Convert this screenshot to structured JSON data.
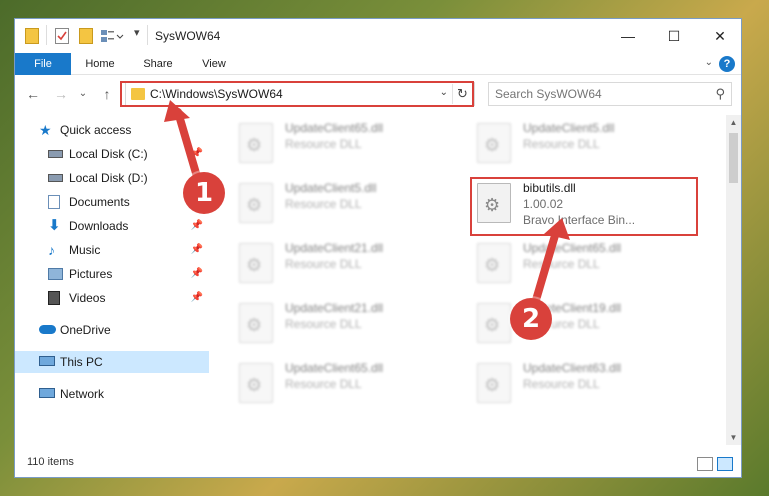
{
  "window": {
    "title": "SysWOW64",
    "controls": {
      "minimize": "—",
      "maximize": "☐",
      "close": "✕"
    }
  },
  "ribbon": {
    "tabs": [
      "File",
      "Home",
      "Share",
      "View"
    ],
    "help": "?"
  },
  "navigation": {
    "back": "←",
    "forward": "→",
    "recent": "⌄",
    "up": "↑",
    "address": "C:\\Windows\\SysWOW64",
    "search_placeholder": "Search SysWOW64"
  },
  "sidebar": {
    "items": [
      {
        "label": "Quick access",
        "icon": "star-icon",
        "pinned": false
      },
      {
        "label": "Local Disk (C:)",
        "icon": "drive-icon",
        "pinned": true
      },
      {
        "label": "Local Disk (D:)",
        "icon": "drive-icon",
        "pinned": false
      },
      {
        "label": "Documents",
        "icon": "documents-icon",
        "pinned": true
      },
      {
        "label": "Downloads",
        "icon": "download-icon",
        "pinned": true
      },
      {
        "label": "Music",
        "icon": "music-icon",
        "pinned": true
      },
      {
        "label": "Pictures",
        "icon": "pictures-icon",
        "pinned": true
      },
      {
        "label": "Videos",
        "icon": "videos-icon",
        "pinned": true
      },
      {
        "label": "OneDrive",
        "icon": "cloud-icon",
        "pinned": false
      },
      {
        "label": "This PC",
        "icon": "computer-icon",
        "pinned": false,
        "selected": true
      },
      {
        "label": "Network",
        "icon": "network-icon",
        "pinned": false
      }
    ],
    "pin_glyph": "📌"
  },
  "files": {
    "left_column": [
      {
        "name": "UpdateClient65.dll",
        "type": "Resource DLL"
      },
      {
        "name": "UpdateClient5.dll",
        "type": "Resource DLL"
      },
      {
        "name": "UpdateClient21.dll",
        "type": "Resource DLL"
      },
      {
        "name": "UpdateClient21.dll",
        "type": "Resource DLL"
      },
      {
        "name": "UpdateClient65.dll",
        "type": "Resource DLL"
      }
    ],
    "right_column": [
      {
        "name": "UpdateClient5.dll",
        "type": "Resource DLL"
      },
      {
        "name": "bibutils.dll",
        "version": "1.00.02",
        "type": "Bravo Interface Bin...",
        "highlighted": true
      },
      {
        "name": "UpdateClient65.dll",
        "type": "Resource DLL"
      },
      {
        "name": "UpdateClient19.dll",
        "type": "Resource DLL"
      },
      {
        "name": "UpdateClient63.dll",
        "type": "Resource DLL"
      }
    ]
  },
  "status": {
    "item_count": "110 items"
  },
  "annotations": {
    "markers": [
      "1",
      "2"
    ],
    "color": "#d9413b"
  },
  "colors": {
    "accent": "#1979ca",
    "selection": "#cce8ff",
    "folder": "#f4c542"
  }
}
